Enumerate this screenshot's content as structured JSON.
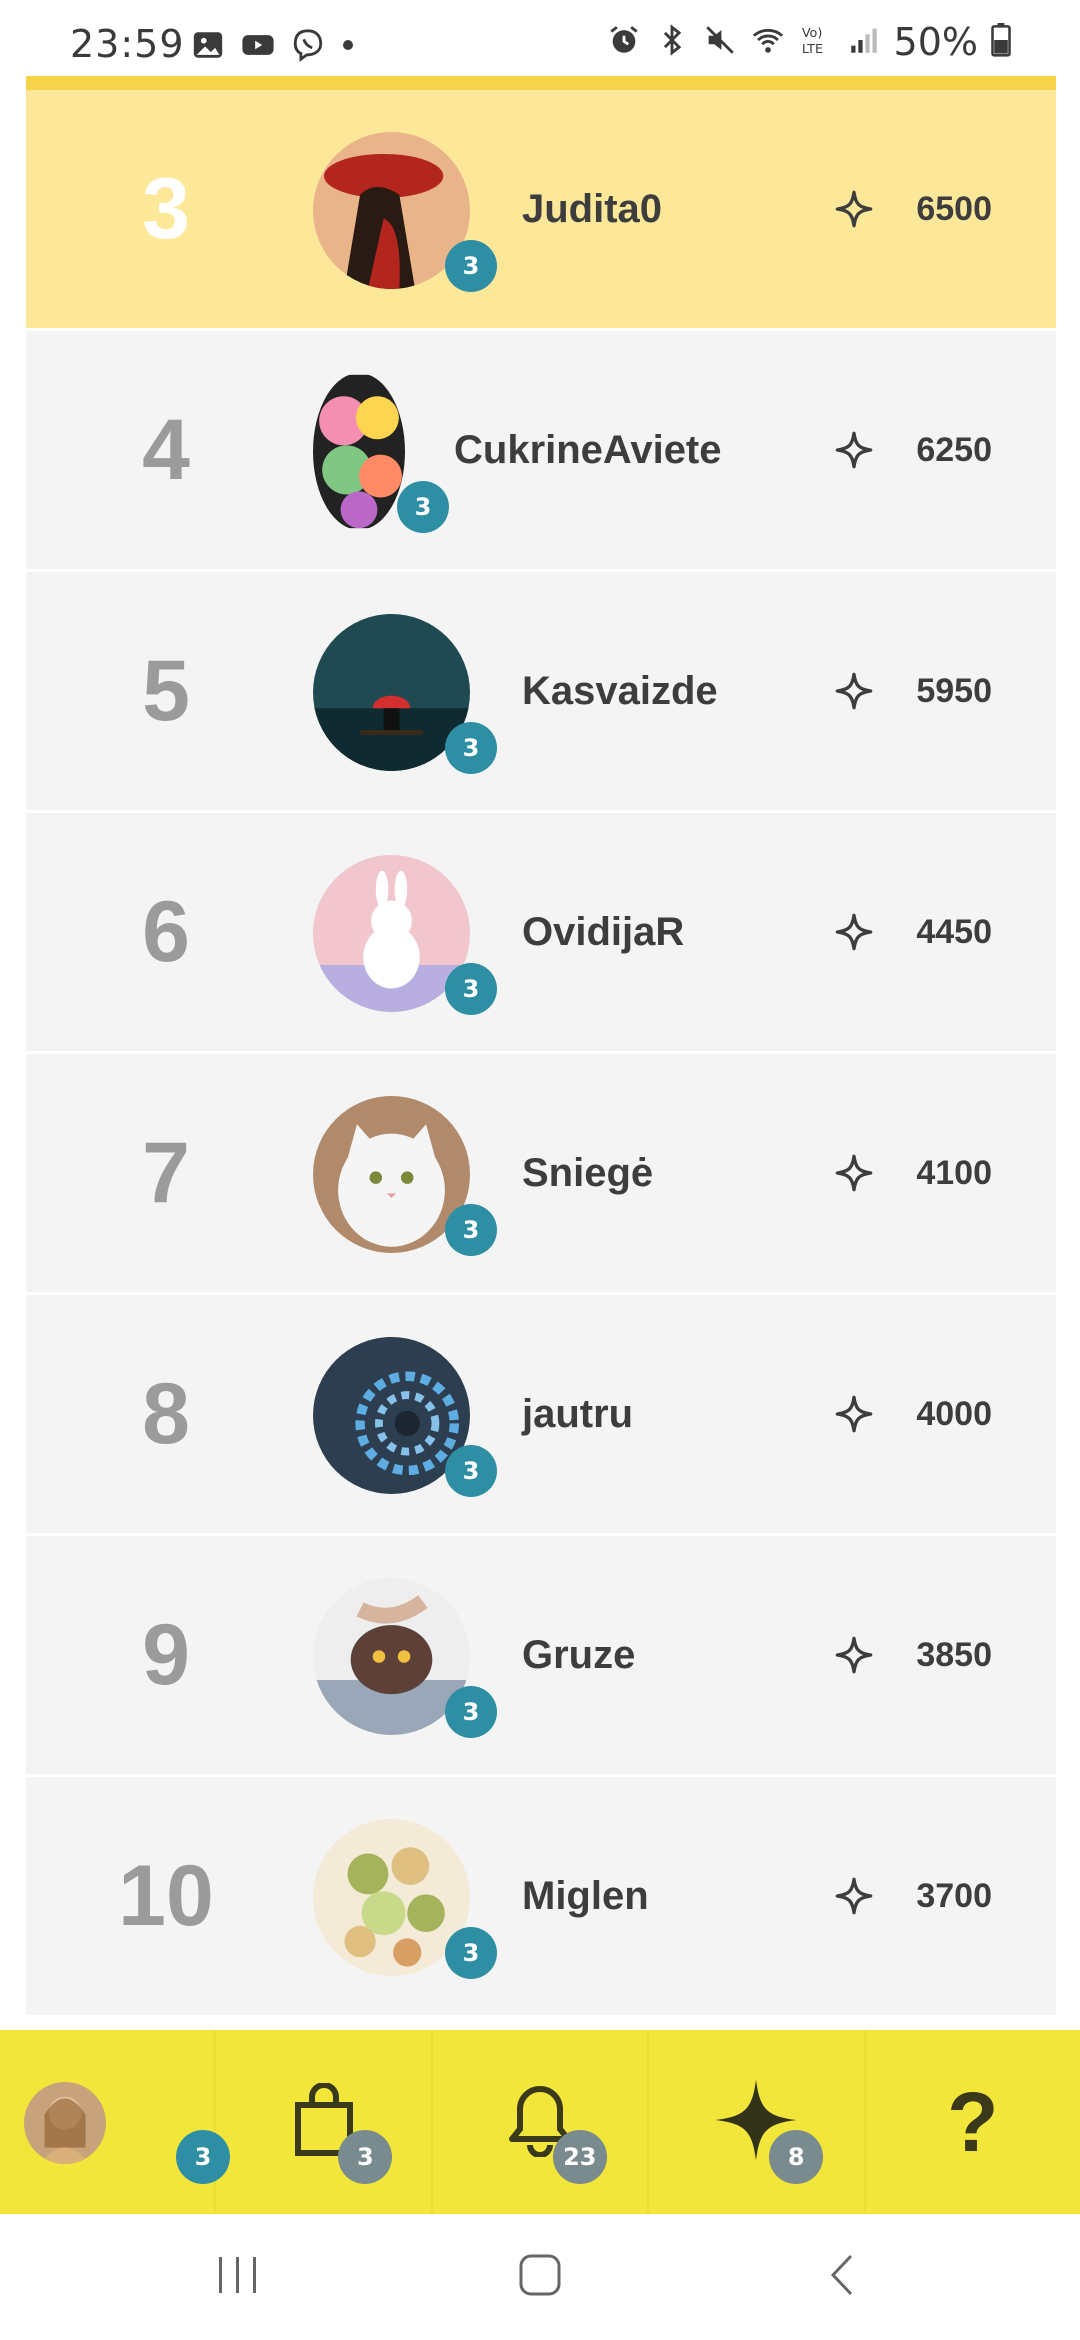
{
  "status_bar": {
    "time": "23:59",
    "battery": "50%",
    "left_icons": [
      "gallery-icon",
      "youtube-icon",
      "viber-icon",
      "dot-icon"
    ],
    "right_icons": [
      "alarm-icon",
      "bluetooth-icon",
      "mute-icon",
      "wifi-icon",
      "volte-icon",
      "signal-icon",
      "battery-icon"
    ]
  },
  "colors": {
    "highlight_row": "#fde89a",
    "row": "#f4f4f4",
    "level_badge": "#2e8fa4",
    "bottom_nav": "#f2e63b",
    "top_strip": "#f6d34a"
  },
  "leaderboard": {
    "rows": [
      {
        "rank": "3",
        "username": "Judita0",
        "level": "3",
        "score": "6500",
        "highlight": true
      },
      {
        "rank": "4",
        "username": "CukrineAviete",
        "level": "3",
        "score": "6250"
      },
      {
        "rank": "5",
        "username": "Kasvaizde",
        "level": "3",
        "score": "5950"
      },
      {
        "rank": "6",
        "username": "OvidijaR",
        "level": "3",
        "score": "4450"
      },
      {
        "rank": "7",
        "username": "Sniegė",
        "level": "3",
        "score": "4100"
      },
      {
        "rank": "8",
        "username": "jautru",
        "level": "3",
        "score": "4000"
      },
      {
        "rank": "9",
        "username": "Gruze",
        "level": "3",
        "score": "3850"
      },
      {
        "rank": "10",
        "username": "Miglen",
        "level": "3",
        "score": "3700"
      }
    ]
  },
  "bottom_nav": {
    "items": [
      {
        "name": "profile",
        "icon": "avatar",
        "badge": "3"
      },
      {
        "name": "shop",
        "icon": "shopping-bag-icon",
        "badge": "3"
      },
      {
        "name": "notifications",
        "icon": "bell-icon",
        "badge": "23"
      },
      {
        "name": "points",
        "icon": "sparkle-icon",
        "badge": "8"
      },
      {
        "name": "help",
        "icon": "question-icon",
        "label": "?"
      }
    ]
  },
  "system_nav": [
    "recents-icon",
    "home-icon",
    "back-icon"
  ]
}
